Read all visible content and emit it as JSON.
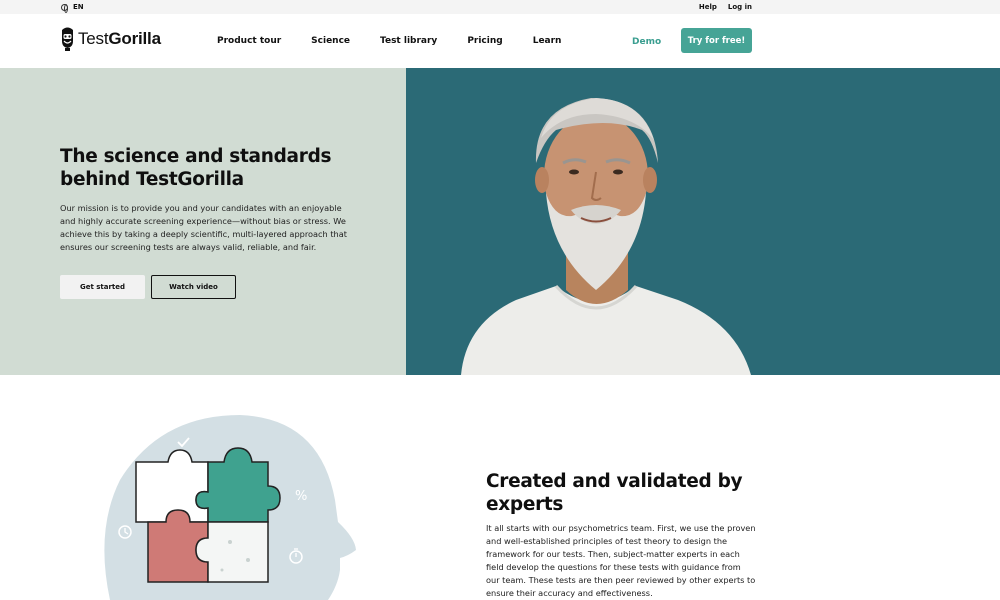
{
  "topbar": {
    "lang": "EN",
    "help": "Help",
    "login": "Log in"
  },
  "brand": {
    "name_light": "Test",
    "name_bold": "Gorilla"
  },
  "nav": {
    "items": [
      "Product tour",
      "Science",
      "Test library",
      "Pricing",
      "Learn"
    ],
    "demo": "Demo",
    "cta": "Try for free!"
  },
  "hero": {
    "title": "The science and standards behind TestGorilla",
    "body": "Our mission is to provide you and your candidates with an enjoyable and highly accurate screening experience—without bias or stress. We achieve this by taking a deeply scientific, multi-layered approach that ensures our screening tests are always valid, reliable, and fair.",
    "primary_button": "Get started",
    "secondary_button": "Watch video"
  },
  "section2": {
    "title": "Created and validated by experts",
    "body": "It all starts with our psychometrics team. First, we use the proven and well-established principles of test theory to design the framework for our tests. Then, subject-matter experts in each field develop the questions for these tests with guidance from our team. These tests are then peer reviewed by other experts to ensure their accuracy and effectiveness."
  },
  "colors": {
    "accent": "#46a496",
    "hero_left_bg": "#d1dcd3",
    "hero_right_bg": "#2b6a76",
    "illus_head": "#d3dfe4",
    "puzzle_green": "#3fa28f",
    "puzzle_red": "#cf7a76"
  },
  "icons": [
    "globe-icon",
    "gorilla-logo-icon",
    "checkmark-icon",
    "percent-icon",
    "clock-icon",
    "stopwatch-icon"
  ]
}
